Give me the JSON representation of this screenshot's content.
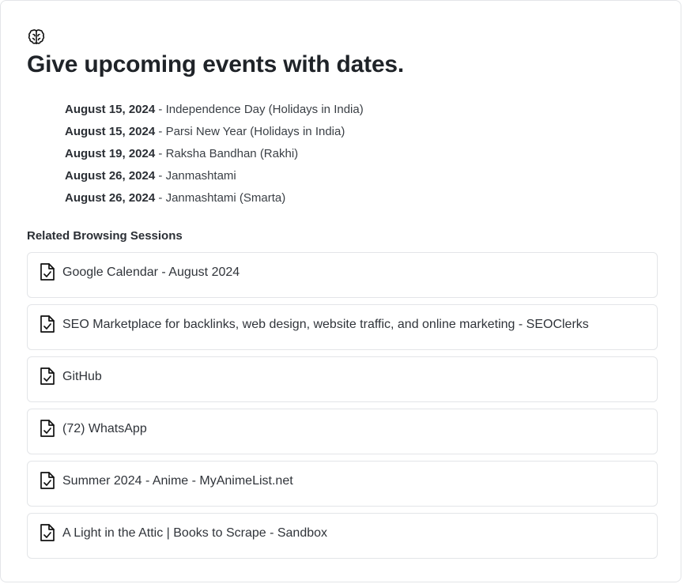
{
  "header": {
    "icon": "brain-icon",
    "title": "Give upcoming events with dates."
  },
  "events": [
    {
      "date": "August 15, 2024",
      "sep": " - ",
      "name": "Independence Day (Holidays in India)"
    },
    {
      "date": "August 15, 2024",
      "sep": " - ",
      "name": "Parsi New Year (Holidays in India)"
    },
    {
      "date": "August 19, 2024",
      "sep": " - ",
      "name": "Raksha Bandhan (Rakhi)"
    },
    {
      "date": "August 26, 2024",
      "sep": " - ",
      "name": "Janmashtami"
    },
    {
      "date": "August 26, 2024",
      "sep": " - ",
      "name": "Janmashtami (Smarta)"
    }
  ],
  "related": {
    "heading": "Related Browsing Sessions",
    "icon": "document-check-icon",
    "sessions": [
      {
        "label": "Google Calendar - August 2024"
      },
      {
        "label": "SEO Marketplace for backlinks, web design, website traffic, and online marketing - SEOClerks"
      },
      {
        "label": "GitHub"
      },
      {
        "label": "(72) WhatsApp"
      },
      {
        "label": "Summer 2024 - Anime - MyAnimeList.net"
      },
      {
        "label": "A Light in the Attic | Books to Scrape - Sandbox"
      }
    ]
  }
}
